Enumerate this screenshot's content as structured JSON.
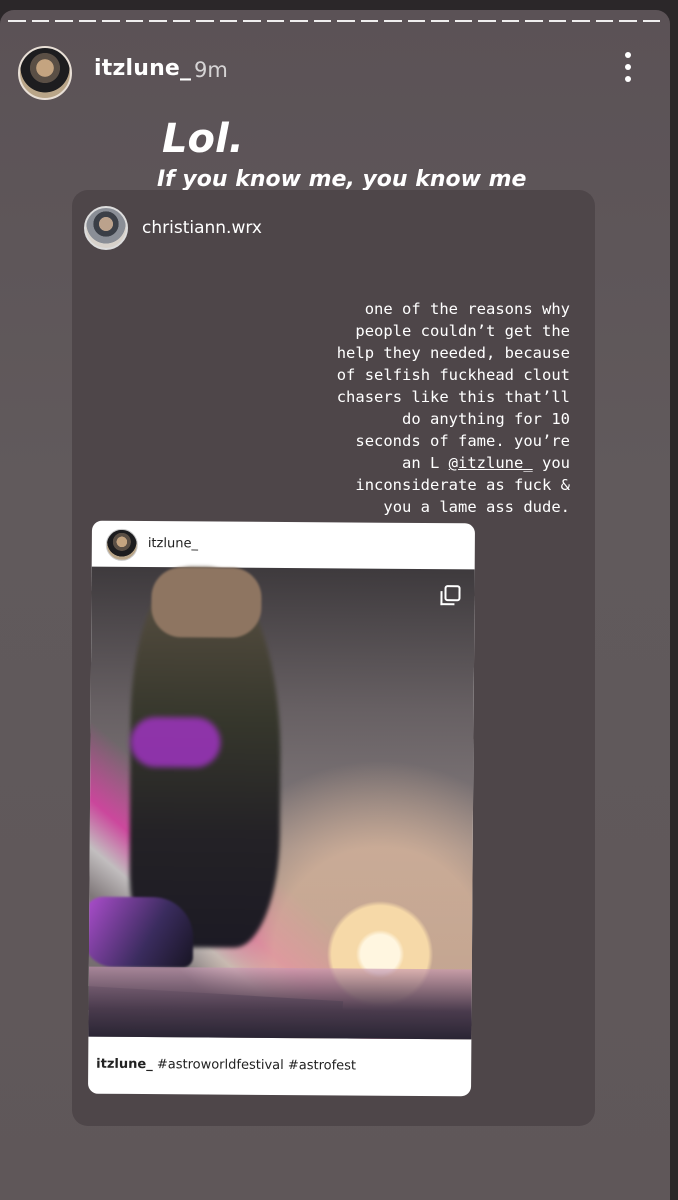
{
  "story": {
    "username": "itzlune_",
    "time": "9m",
    "caption_line1": "Lol.",
    "caption_line2": "If you know me, you know me"
  },
  "shared": {
    "username": "christiann.wrx",
    "quote_before": "one of the reasons why\npeople couldn’t get the\nhelp they needed, because\nof selfish fuckhead clout\nchasers like this that’ll\ndo anything for 10\nseconds of fame. you’re\nan L ",
    "mention": "@itzlune_",
    "quote_after": " you\ninconsiderate as fuck &\nyou a lame ass dude."
  },
  "post": {
    "username": "itzlune_",
    "caption_user": "itzlune_",
    "caption_text": " #astroworldfestival #astrofest"
  }
}
